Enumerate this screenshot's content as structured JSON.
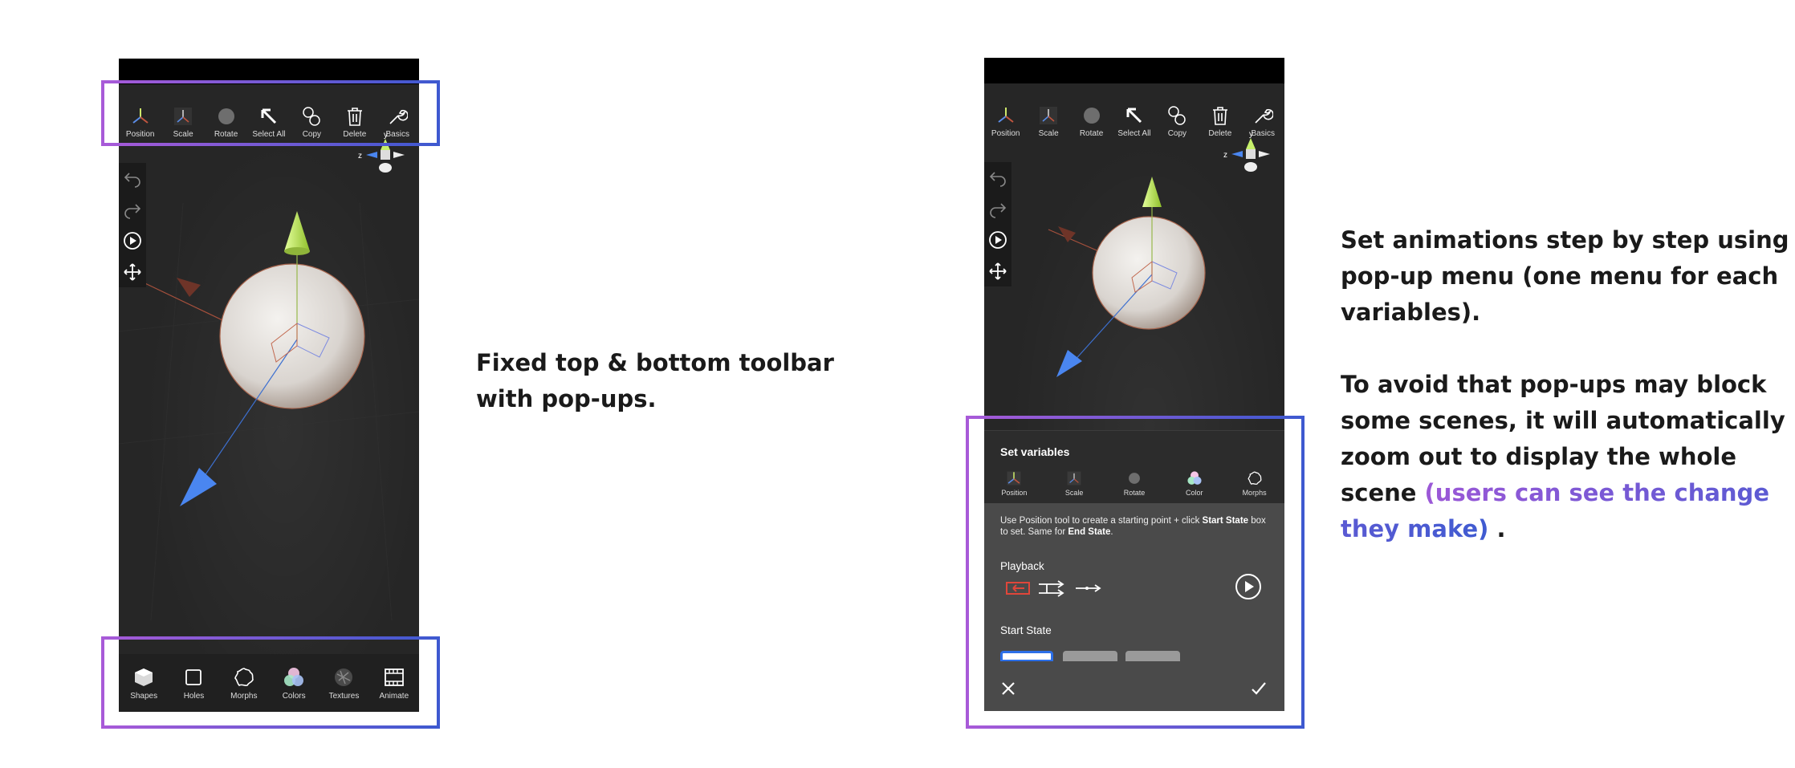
{
  "toolbar": {
    "items": [
      {
        "label": "Position",
        "icon": "position-axes-icon"
      },
      {
        "label": "Scale",
        "icon": "scale-axes-icon"
      },
      {
        "label": "Rotate",
        "icon": "rotate-sphere-icon"
      },
      {
        "label": "Select All",
        "icon": "arrow-up-left-icon"
      },
      {
        "label": "Copy",
        "icon": "copy-circles-icon"
      },
      {
        "label": "Delete",
        "icon": "trash-icon"
      },
      {
        "label": "Basics",
        "icon": "wrench-icon"
      }
    ]
  },
  "gizmo": {
    "y_label": "y",
    "z_label": "z"
  },
  "sidebar": {
    "icons": [
      "undo-icon",
      "redo-icon",
      "play-icon",
      "move-icon"
    ]
  },
  "bottombar": {
    "items": [
      {
        "label": "Shapes",
        "icon": "cube-icon"
      },
      {
        "label": "Holes",
        "icon": "square-icon"
      },
      {
        "label": "Morphs",
        "icon": "blob-icon"
      },
      {
        "label": "Colors",
        "icon": "color-circles-icon"
      },
      {
        "label": "Textures",
        "icon": "texture-icon"
      },
      {
        "label": "Animate",
        "icon": "film-icon"
      }
    ]
  },
  "captions": {
    "left": "Fixed top & bottom toolbar with pop-ups.",
    "right_p1": "Set animations step by step using pop-up menu (one menu for each variables).",
    "right_p2_a": "To avoid that pop-ups may block some scenes, it will automatically zoom out to display the whole scene",
    "right_p2_highlight": "(users can see the change they make)",
    "right_p2_end": "."
  },
  "popup": {
    "title": "Set variables",
    "tools": [
      {
        "label": "Position",
        "icon": "position-axes-icon"
      },
      {
        "label": "Scale",
        "icon": "scale-axes-icon"
      },
      {
        "label": "Rotate",
        "icon": "rotate-sphere-icon"
      },
      {
        "label": "Color",
        "icon": "color-circles-icon"
      },
      {
        "label": "Morphs",
        "icon": "blob-icon"
      }
    ],
    "desc_a": "Use Position tool to create a starting point + click ",
    "desc_b": "Start State",
    "desc_c": " box to set. Same for ",
    "desc_d": "End State",
    "desc_e": ".",
    "playback_label": "Playback",
    "start_state_label": "Start State",
    "close_icon": "close-icon",
    "confirm_icon": "check-icon"
  },
  "colors": {
    "frame_start": "#a85ad8",
    "frame_end": "#3e59d0",
    "highlight": "#8a5fd8",
    "cone_green": "#c6f06a",
    "cone_blue": "#4a86f0",
    "cone_red": "#7a3a2e",
    "loop_red": "#e0463a"
  }
}
